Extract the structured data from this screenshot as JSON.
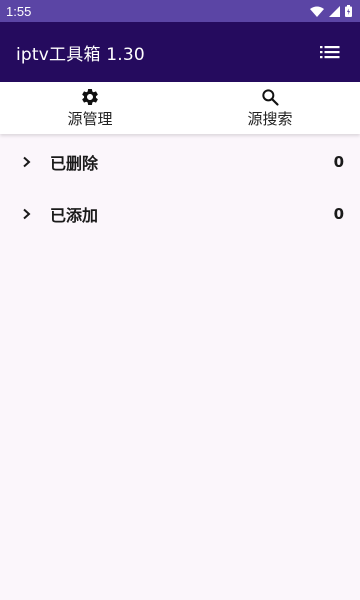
{
  "status_bar": {
    "time": "1:55",
    "icons": [
      "wifi-icon",
      "signal-icon",
      "battery-icon"
    ]
  },
  "app_bar": {
    "title": "iptv工具箱 1.30",
    "menu_icon": "menu-icon"
  },
  "tabs": [
    {
      "label": "源管理",
      "icon": "gear-icon"
    },
    {
      "label": "源搜索",
      "icon": "search-icon"
    }
  ],
  "list": [
    {
      "label": "已删除",
      "count": "0"
    },
    {
      "label": "已添加",
      "count": "0"
    }
  ],
  "colors": {
    "status_bar": "#5b45a5",
    "app_bar": "#250b5e",
    "background": "#fbf6fb"
  }
}
